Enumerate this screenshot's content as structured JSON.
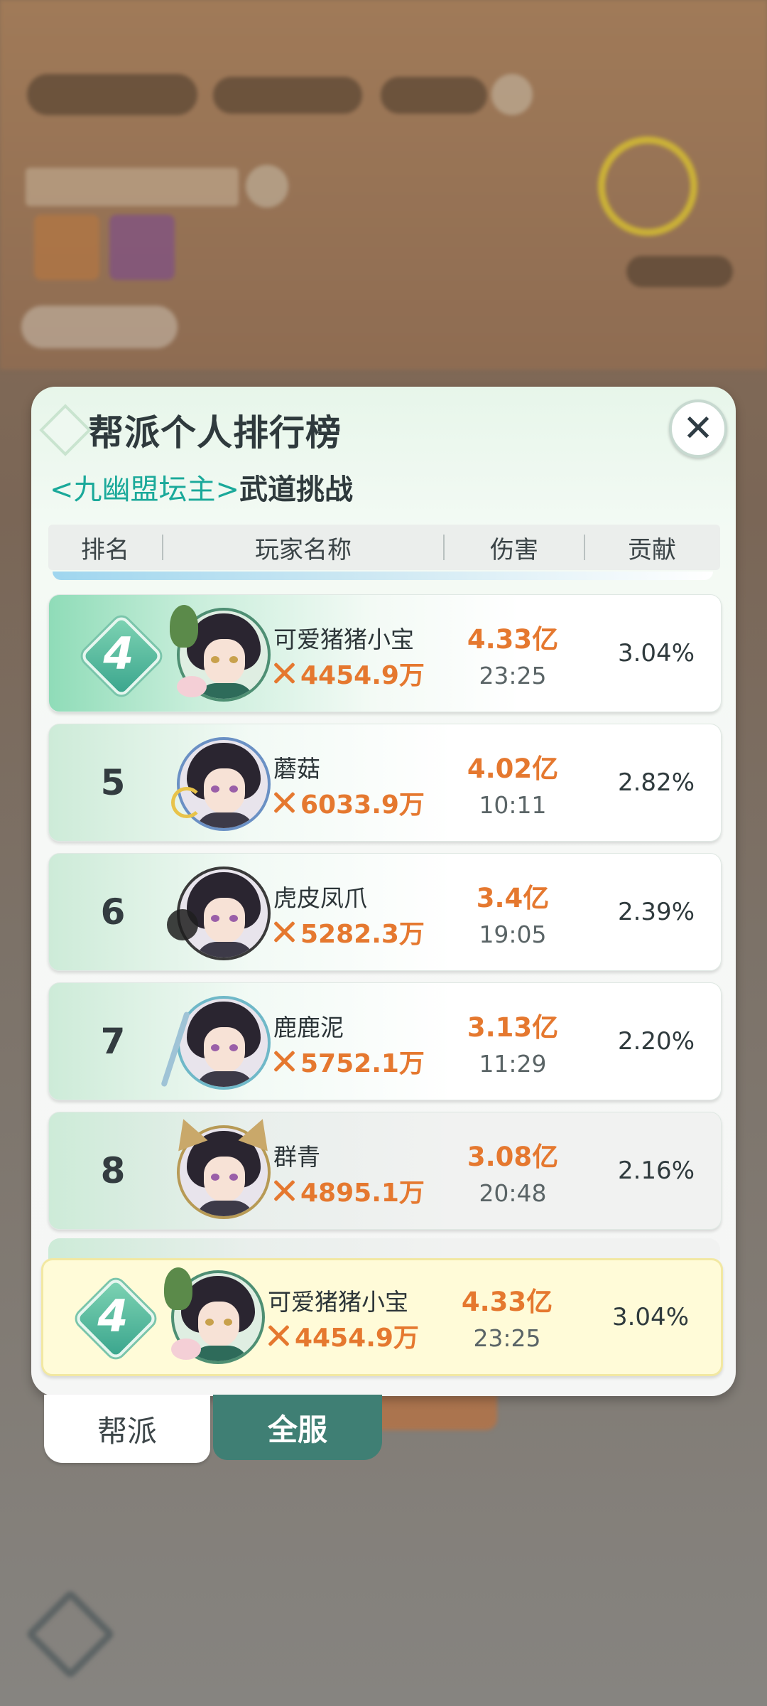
{
  "dialog": {
    "title": "帮派个人排行榜",
    "subtitle_highlight": "<九幽盟坛主>",
    "subtitle_rest": "武道挑战",
    "close_symbol": "✕"
  },
  "table": {
    "headers": {
      "rank": "排名",
      "name": "玩家名称",
      "damage": "伤害",
      "contribution": "贡献"
    },
    "rows": [
      {
        "rank": "4",
        "name": "可爱猪猪小宝",
        "power": "4454.9万",
        "damage": "4.33亿",
        "time": "23:25",
        "contribution": "3.04%"
      },
      {
        "rank": "5",
        "name": "蘑菇",
        "power": "6033.9万",
        "damage": "4.02亿",
        "time": "10:11",
        "contribution": "2.82%"
      },
      {
        "rank": "6",
        "name": "虎皮凤爪",
        "power": "5282.3万",
        "damage": "3.4亿",
        "time": "19:05",
        "contribution": "2.39%"
      },
      {
        "rank": "7",
        "name": "鹿鹿泥",
        "power": "5752.1万",
        "damage": "3.13亿",
        "time": "11:29",
        "contribution": "2.20%"
      },
      {
        "rank": "8",
        "name": "群青",
        "power": "4895.1万",
        "damage": "3.08亿",
        "time": "20:48",
        "contribution": "2.16%"
      }
    ],
    "my_row": {
      "rank": "4",
      "name": "可爱猪猪小宝",
      "power": "4454.9万",
      "damage": "4.33亿",
      "time": "23:25",
      "contribution": "3.04%"
    }
  },
  "tabs": {
    "guild": "帮派",
    "server": "全服"
  },
  "colors": {
    "accent_orange": "#e5782f",
    "teal": "#1aa99a",
    "tab_green": "#3f7f74"
  }
}
